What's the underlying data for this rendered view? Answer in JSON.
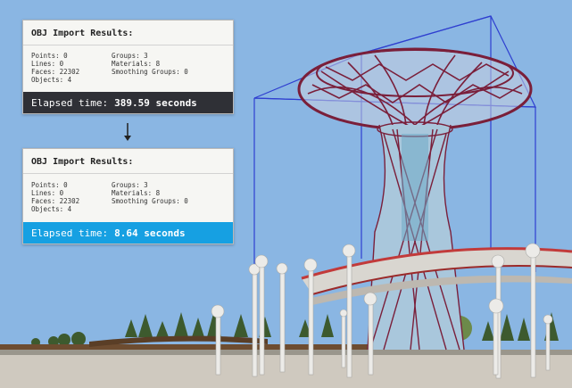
{
  "colors": {
    "sky": "#8ab6e3",
    "dark_bar": "#2f3036",
    "blue_bar": "#16a0e2",
    "bounding_box": "#2f3fd0",
    "structure": "#7a1f3a"
  },
  "before": {
    "title": "OBJ Import Results:",
    "points": "Points: 0",
    "lines": "Lines: 0",
    "faces": "Faces: 22302",
    "objects": "Objects: 4",
    "groups": "Groups: 3",
    "materials": "Materials: 8",
    "smoothing": "Smoothing Groups: 0",
    "elapsed_label": "Elapsed time:",
    "elapsed_value": "389.59 seconds"
  },
  "after": {
    "title": "OBJ Import Results:",
    "points": "Points: 0",
    "lines": "Lines: 0",
    "faces": "Faces: 22302",
    "objects": "Objects: 4",
    "groups": "Groups: 3",
    "materials": "Materials: 8",
    "smoothing": "Smoothing Groups: 0",
    "elapsed_label": "Elapsed time:",
    "elapsed_value": "8.64 seconds"
  },
  "icons": {
    "arrow": "arrow-down-icon"
  }
}
